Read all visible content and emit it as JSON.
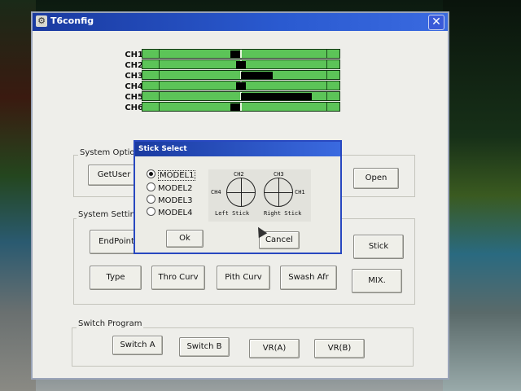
{
  "window": {
    "title": "T6config",
    "close_glyph": "✕"
  },
  "channels": [
    {
      "label": "CH1",
      "level": 0.47
    },
    {
      "label": "CH2",
      "level": 0.5
    },
    {
      "label": "CH3",
      "level": 0.66
    },
    {
      "label": "CH4",
      "level": 0.5
    },
    {
      "label": "CH5",
      "level": 0.86
    },
    {
      "label": "CH6",
      "level": 0.47
    }
  ],
  "system_options": {
    "title": "System Optio",
    "getuser": "GetUser",
    "open": "Open"
  },
  "system_settings": {
    "title": "System Settin",
    "endpoint": "EndPoint",
    "stick": "Stick",
    "type": "Type",
    "thro_curv": "Thro Curv",
    "pith_curv": "Pith Curv",
    "swash_afr": "Swash Afr",
    "mix": "MIX."
  },
  "switch_program": {
    "title": "Switch Program",
    "switch_a": "Switch A",
    "switch_b": "Switch B",
    "vra": "VR(A)",
    "vrb": "VR(B)"
  },
  "dialog": {
    "title": "Stick Select",
    "models": [
      "MODEL1",
      "MODEL2",
      "MODEL3",
      "MODEL4"
    ],
    "selected": "MODEL1",
    "ch_labels": {
      "left_top": "CH2",
      "left_side": "CH4",
      "right_top": "CH3",
      "right_side": "CH1"
    },
    "left_stick": "Left Stick",
    "right_stick": "Right Stick",
    "ok": "Ok",
    "cancel": "Cancel"
  }
}
